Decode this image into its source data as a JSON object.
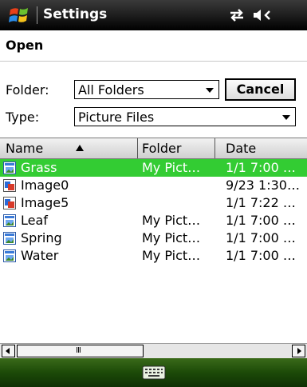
{
  "titlebar": {
    "title": "Settings",
    "icons": [
      "windows-start-icon",
      "connectivity-icon",
      "volume-icon"
    ]
  },
  "dialog": {
    "caption": "Open"
  },
  "form": {
    "folder_label": "Folder:",
    "folder_value": "All Folders",
    "type_label": "Type:",
    "type_value": "Picture Files",
    "cancel_label": "Cancel"
  },
  "list": {
    "columns": [
      "Name",
      "Folder",
      "Date"
    ],
    "sort": "Name ascending",
    "rows": [
      {
        "name": "Grass",
        "folder": "My Pict…",
        "date": "1/1 7:00 …",
        "icon": "picture-file-icon",
        "selected": true
      },
      {
        "name": "Image0",
        "folder": "",
        "date": "9/23 1:30…",
        "icon": "image-file-icon",
        "selected": false
      },
      {
        "name": "Image5",
        "folder": "",
        "date": "1/1 7:22 …",
        "icon": "image-file-icon",
        "selected": false
      },
      {
        "name": "Leaf",
        "folder": "My Pict…",
        "date": "1/1 7:00 …",
        "icon": "picture-file-icon",
        "selected": false
      },
      {
        "name": "Spring",
        "folder": "My Pict…",
        "date": "1/1 7:00 …",
        "icon": "picture-file-icon",
        "selected": false
      },
      {
        "name": "Water",
        "folder": "My Pict…",
        "date": "1/1 7:00 …",
        "icon": "picture-file-icon",
        "selected": false
      }
    ]
  },
  "scrollbar": {
    "grip": "III"
  },
  "menubar": {
    "icons": [
      "keyboard-icon"
    ]
  },
  "colors": {
    "selection": "#33cc33",
    "titlebar": "#1b1b1b",
    "menubar": "#1c4a08"
  }
}
